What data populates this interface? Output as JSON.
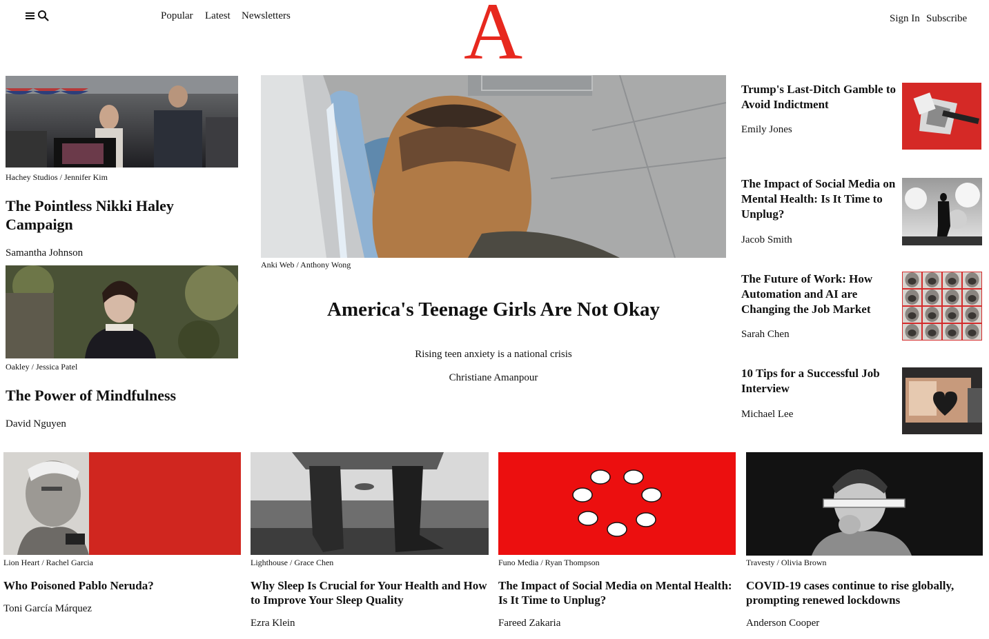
{
  "header": {
    "menu_icon": "hamburger-icon",
    "search_icon": "search-icon",
    "nav": [
      "Popular",
      "Latest",
      "Newsletters"
    ],
    "logo": "A",
    "sign_in": "Sign In",
    "subscribe": "Subscribe"
  },
  "left": [
    {
      "credit": "Hachey Studios / Jennifer Kim",
      "headline": "The Pointless Nikki Haley Campaign",
      "author": "Samantha Johnson"
    },
    {
      "credit": "Oakley / Jessica Patel",
      "headline": "The Power of Mindfulness",
      "author": "David Nguyen"
    }
  ],
  "feature": {
    "credit": "Anki Web / Anthony Wong",
    "headline": "America's Teenage Girls Are Not Okay",
    "dek": "Rising teen anxiety is a national crisis",
    "author": "Christiane Amanpour"
  },
  "right": [
    {
      "headline": "Trump's Last-Ditch Gamble to Avoid Indictment",
      "author": "Emily Jones"
    },
    {
      "headline": "The Impact of Social Media on Mental Health: Is It Time to Unplug?",
      "author": "Jacob Smith"
    },
    {
      "headline": "The Future of Work: How Automation and AI are Changing the Job Market",
      "author": "Sarah Chen"
    },
    {
      "headline": "10 Tips for a Successful Job Interview",
      "author": "Michael Lee"
    }
  ],
  "bottom": [
    {
      "credit": "Lion Heart / Rachel Garcia",
      "headline": "Who Poisoned Pablo Neruda?",
      "author": "Toni García Márquez"
    },
    {
      "credit": "Lighthouse / Grace Chen",
      "headline": "Why Sleep Is Crucial for Your Health and How to Improve Your Sleep Quality",
      "author": "Ezra Klein"
    },
    {
      "credit": "Funo Media / Ryan Thompson",
      "headline": "The Impact of Social Media on Mental Health: Is It Time to Unplug?",
      "author": "Fareed Zakaria"
    },
    {
      "credit": "Travesty / Olivia Brown",
      "headline": "COVID-19 cases continue to rise globally, prompting renewed lockdowns",
      "author": "Anderson Cooper"
    }
  ]
}
